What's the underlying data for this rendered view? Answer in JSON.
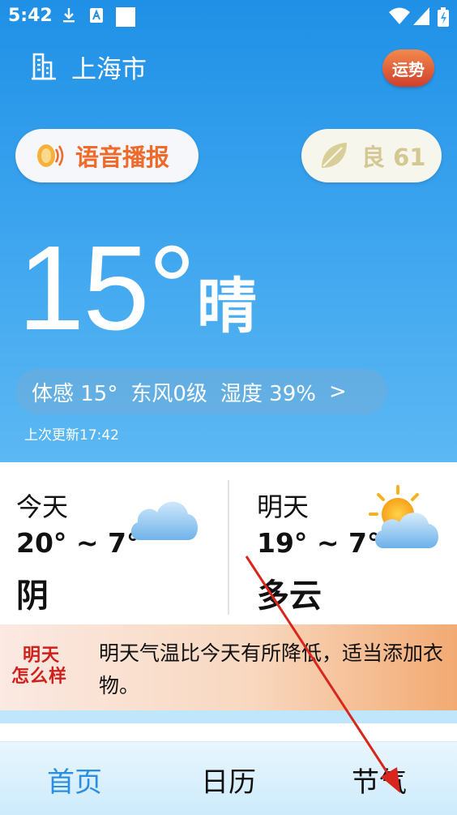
{
  "status": {
    "time": "5:42",
    "icons": [
      "download-icon",
      "a-icon",
      "square-icon",
      "wifi-icon",
      "signal-icon",
      "battery-icon"
    ]
  },
  "header": {
    "city": "上海市",
    "fortune_label": "运势"
  },
  "voice": {
    "label": "语音播报"
  },
  "aqi": {
    "label": "良 61"
  },
  "current": {
    "temperature": "15°",
    "condition": "晴"
  },
  "details": {
    "feels": "体感 15°",
    "wind": "东风0级",
    "humidity": "湿度 39%",
    "chevron": ">"
  },
  "updated": "上次更新17:42",
  "forecast": {
    "today": {
      "label": "今天",
      "range": "20° ~ 7°",
      "condition": "阴"
    },
    "tomorrow": {
      "label": "明天",
      "range": "19° ~ 7°",
      "condition": "多云"
    }
  },
  "tip": {
    "badge_line1": "明天",
    "badge_line2": "怎么样",
    "text": "明天气温比今天有所降低，适当添加衣物。"
  },
  "nav": {
    "home": "首页",
    "calendar": "日历",
    "third": "节气"
  },
  "colors": {
    "accent": "#2a8fe0",
    "top_bg": "#3aa3ee",
    "voice_text": "#ef6a2b",
    "annotation_arrow": "#d9261c"
  }
}
